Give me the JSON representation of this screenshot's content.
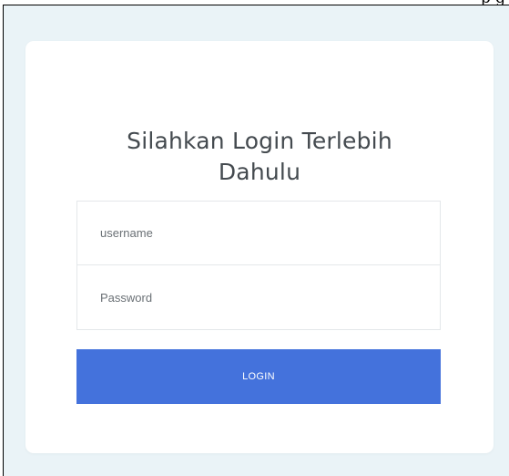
{
  "page": {
    "top_fragment": "p       g"
  },
  "login": {
    "title_line1": "Silahkan Login Terlebih",
    "title_line2": "Dahulu",
    "username_placeholder": "username",
    "password_placeholder": "Password",
    "button_label": "LOGIN"
  },
  "colors": {
    "background": "#eaf3f7",
    "card": "#ffffff",
    "button": "#4472dc",
    "button_text": "#ffffff",
    "title_text": "#444a4f"
  }
}
